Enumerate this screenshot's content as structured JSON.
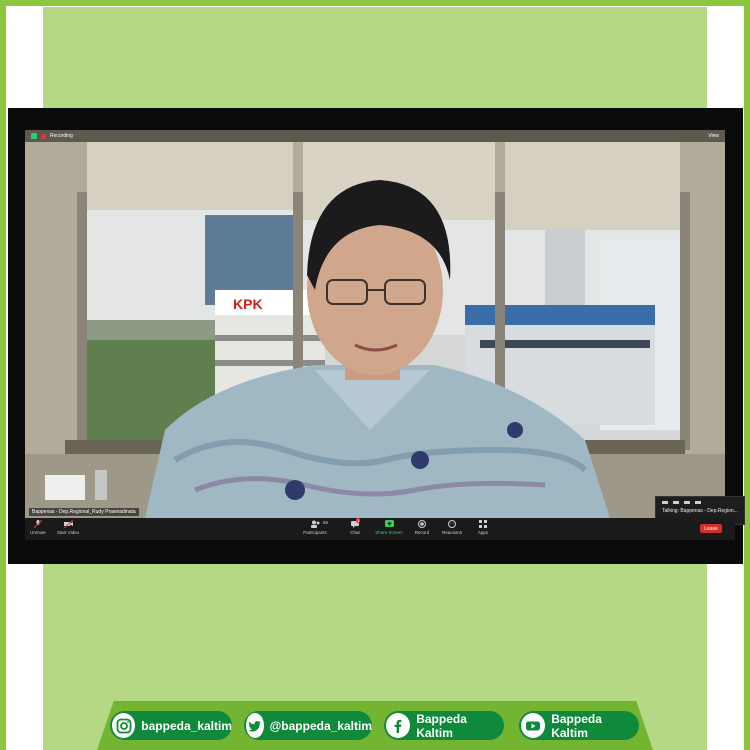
{
  "meeting": {
    "recording_label": "Recording",
    "view_label": "View",
    "participant_name": "Bappenas - Dep.Regional_Rudy Prawiradinata",
    "talking_text": "Talking: Bappenas - Dep.Region..."
  },
  "toolbar": {
    "unmute": "Unmute",
    "start_video": "Start Video",
    "participants": "Participants",
    "participants_count": "66",
    "chat": "Chat",
    "chat_badge": "1",
    "share_screen": "Share Screen",
    "record": "Record",
    "reactions": "Reactions",
    "apps": "Apps",
    "leave": "Leave"
  },
  "scene": {
    "building_sign": "KPK"
  },
  "social": {
    "instagram": "bappeda_kaltim",
    "twitter": "@bappeda_kaltim",
    "facebook": "Bappeda Kaltim",
    "youtube": "Bappeda Kaltim"
  },
  "colors": {
    "frame_green": "#8cc63f",
    "panel_green": "#b5d884",
    "social_bar_green": "#73b532",
    "pill_green": "#0f8a3b",
    "leave_red": "#d0312d",
    "share_green": "#3ad05d"
  },
  "icons": [
    "instagram-icon",
    "twitter-icon",
    "facebook-icon",
    "youtube-icon",
    "mic-off-icon",
    "video-off-icon",
    "participants-icon",
    "chat-icon",
    "share-screen-icon",
    "record-icon",
    "reactions-icon",
    "apps-icon",
    "shield-icon"
  ]
}
